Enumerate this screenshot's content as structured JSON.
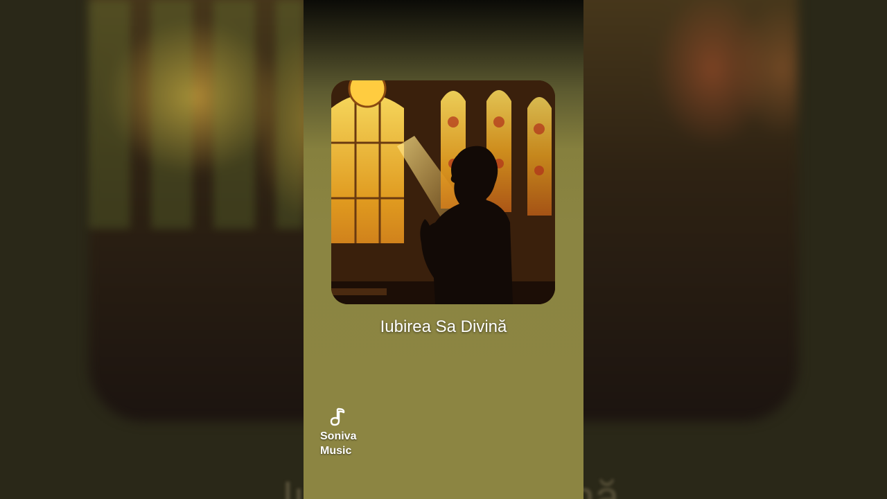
{
  "song": {
    "title": "Iubirea Sa Divină"
  },
  "brand": {
    "name": "Soniva\nMusic",
    "icon": "music-note-icon"
  },
  "artwork": {
    "description_icon": "cover-art"
  },
  "colors": {
    "panel": "#8c8542",
    "backdrop": "#2a2818",
    "text": "#ffffff"
  }
}
